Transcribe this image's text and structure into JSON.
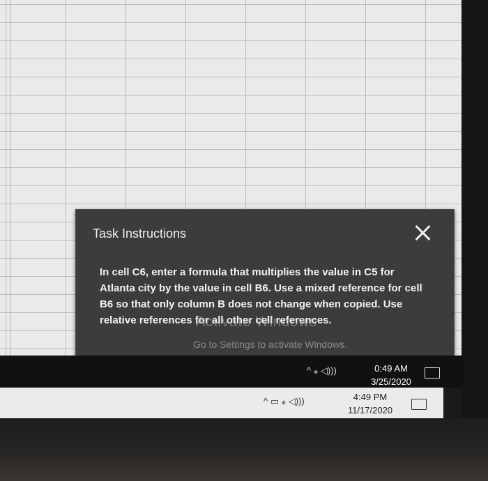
{
  "dialog": {
    "title": "Task Instructions",
    "body": "In cell C6, enter a formula that multiplies the value in C5 for Atlanta city by the value in cell B6. Use a mixed reference for cell B6 so that only column B does not change when copied. Use relative references for all other cell references."
  },
  "watermark": {
    "title": "Activate Windows",
    "subtitle": "Go to Settings to activate Windows."
  },
  "taskbar_top": {
    "time": "0:49 AM",
    "date": "3/25/2020",
    "tray_icons": [
      "chevron-up-icon",
      "wifi-icon",
      "volume-icon"
    ],
    "tray_text": "^ ⁎ ◁)))"
  },
  "taskbar_bottom": {
    "time": "4:49 PM",
    "date": "11/17/2020",
    "tray_icons": [
      "chevron-up-icon",
      "battery-icon",
      "wifi-icon",
      "volume-icon"
    ],
    "tray_text": "^ ▭ ⁎ ◁)))"
  },
  "colors": {
    "dialog_bg": "#3c3c3c",
    "sheet_bg": "#e9eaea",
    "taskbar_dark": "#111111",
    "taskbar_light": "#ebebeb"
  }
}
